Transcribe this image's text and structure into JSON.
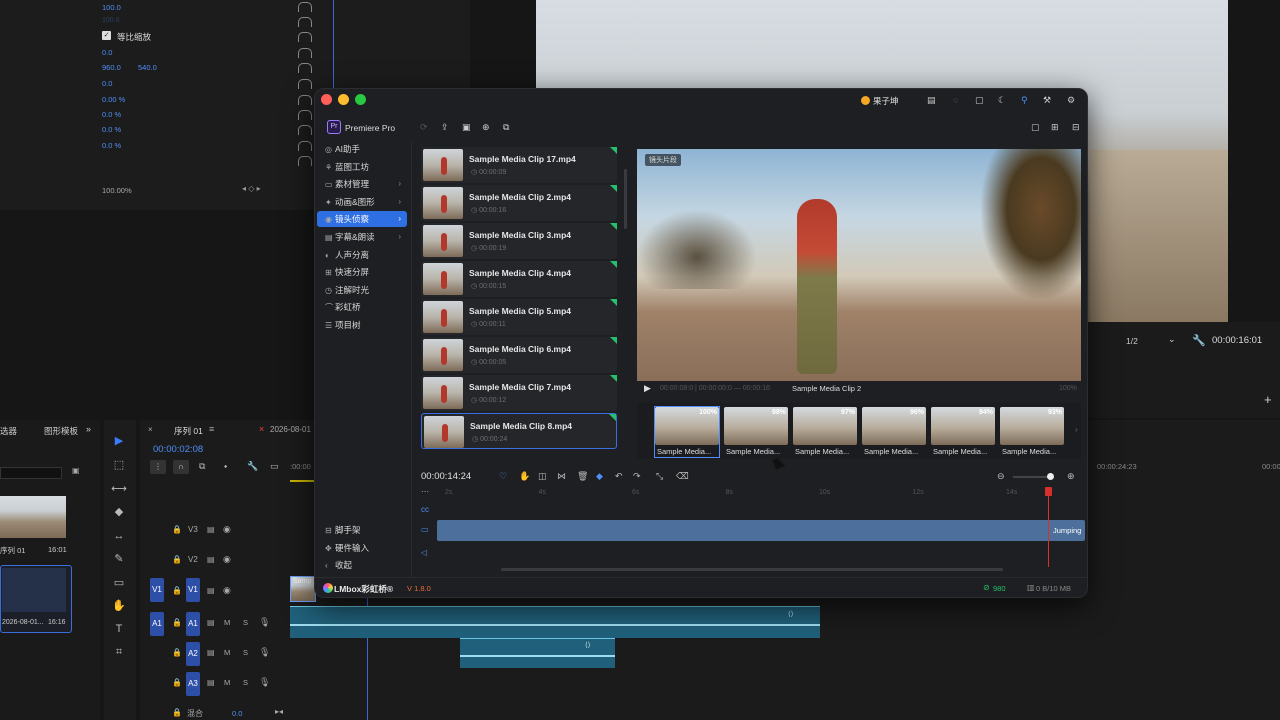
{
  "premiere": {
    "effect_values": [
      "100.0",
      "100.0",
      "0.0",
      "960.0",
      "540.0",
      "0.0",
      "0.00 %",
      "0.0 %",
      "0.0 %",
      "0.0 %"
    ],
    "uniform_scale_label": "等比缩放",
    "opacity_value": "100.00%",
    "panel_tab_left": "选器",
    "panel_tab_graphics": "图形模板",
    "sequence_tab": "序列 01",
    "date_tab": "2026-08-01",
    "timecode": "00:00:02:08",
    "ruler_start": ":00:00",
    "project_items": [
      {
        "name": "序列 01",
        "duration": "16:01"
      },
      {
        "name": "2026-08-01...",
        "duration": "16:16"
      }
    ],
    "tracks_video": [
      "V3",
      "V2",
      "V1"
    ],
    "tracks_audio": [
      "A1",
      "A2",
      "A3"
    ],
    "mix_label": "混合",
    "mix_value": "0.0",
    "program": {
      "fraction": "1/2",
      "timecode": "00:00:16:01",
      "ruler_timecode": "00:00:24:23",
      "ruler_right": "00:00"
    },
    "clip_label_v1": "Samp"
  },
  "plugin": {
    "host_app": "Premiere Pro",
    "user_name": "果子坤",
    "version": "V 1.8.0",
    "brand": "LMbox彩虹桥®",
    "sidebar": [
      {
        "label": "AI助手",
        "icon": "ai-icon",
        "arrow": false
      },
      {
        "label": "蓝图工坊",
        "icon": "blueprint-icon",
        "arrow": false
      },
      {
        "label": "素材管理",
        "icon": "folder-icon",
        "arrow": true
      },
      {
        "label": "动画&图形",
        "icon": "animation-icon",
        "arrow": true
      },
      {
        "label": "镜头侦察",
        "icon": "camera-icon",
        "arrow": true,
        "active": true
      },
      {
        "label": "字幕&朗读",
        "icon": "subtitle-icon",
        "arrow": true
      },
      {
        "label": "人声分离",
        "icon": "voice-icon",
        "arrow": false
      },
      {
        "label": "快速分屏",
        "icon": "split-icon",
        "arrow": false
      },
      {
        "label": "注解时光",
        "icon": "clock-icon",
        "arrow": false
      },
      {
        "label": "彩虹桥",
        "icon": "rainbow-icon",
        "arrow": false
      },
      {
        "label": "项目树",
        "icon": "tree-icon",
        "arrow": false
      }
    ],
    "sidebar_bottom": [
      {
        "label": "脚手架",
        "icon": "scaffold-icon"
      },
      {
        "label": "硬件输入",
        "icon": "hardware-icon"
      },
      {
        "label": "收起",
        "icon": "collapse-icon"
      }
    ],
    "clips": [
      {
        "name": "Sample Media Clip 17.mp4",
        "duration": "00:00:09"
      },
      {
        "name": "Sample Media Clip 2.mp4",
        "duration": "00:00:16"
      },
      {
        "name": "Sample Media Clip 3.mp4",
        "duration": "00:00:19"
      },
      {
        "name": "Sample Media Clip 4.mp4",
        "duration": "00:00:15"
      },
      {
        "name": "Sample Media Clip 5.mp4",
        "duration": "00:00:11"
      },
      {
        "name": "Sample Media Clip 6.mp4",
        "duration": "00:00:05"
      },
      {
        "name": "Sample Media Clip 7.mp4",
        "duration": "00:00:12"
      },
      {
        "name": "Sample Media Clip 8.mp4",
        "duration": "00:00:24"
      }
    ],
    "preview": {
      "badge": "镜头片段",
      "time_text": "00:00:08:0 | 00:00:00:0 — 00:00:16",
      "clip_name": "Sample Media Clip 2",
      "zoom": "100%"
    },
    "matches": [
      {
        "label": "Sample Media...",
        "percent": "100%"
      },
      {
        "label": "Sample Media...",
        "percent": "98%"
      },
      {
        "label": "Sample Media...",
        "percent": "97%"
      },
      {
        "label": "Sample Media...",
        "percent": "96%"
      },
      {
        "label": "Sample Media...",
        "percent": "94%"
      },
      {
        "label": "Sample Media...",
        "percent": "93%"
      }
    ],
    "timeline": {
      "timecode": "00:00:14:24",
      "ruler": [
        "2s",
        "4s",
        "6s",
        "8s",
        "10s",
        "12s",
        "14s"
      ],
      "clip_end_label": "Jumping"
    },
    "footer": {
      "count": "980",
      "memory": "0 B/10 MB"
    }
  }
}
